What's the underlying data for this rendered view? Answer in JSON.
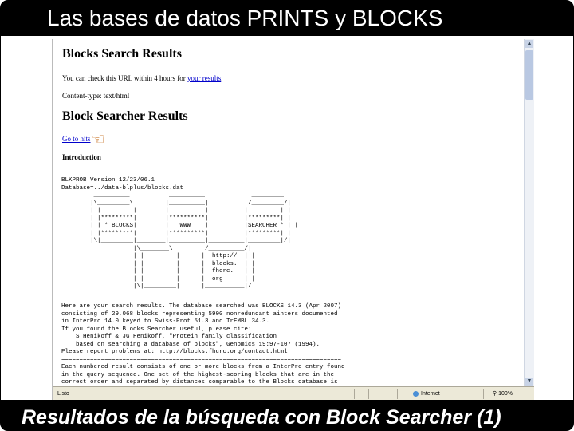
{
  "slide": {
    "title": "Las bases de datos PRINTS y BLOCKS",
    "caption": "Resultados de la búsqueda con Block Searcher (1)"
  },
  "page": {
    "heading": "Blocks Search Results",
    "check_text": "You can check this URL within 4 hours for ",
    "results_link": "your results",
    "check_suffix": ".",
    "content_type": "Content-type: text/html",
    "subheading": "Block Searcher Results",
    "goto_link": "Go to hits",
    "hand_icon": "pointing-hand-icon",
    "introduction": "Introduction",
    "ascii_block": "BLKPROB Version 12/23/06.1\nDatabase=../data-blplus/blocks.dat\n         __________           __________             _________\n        |\\_________\\         |__________|           /_________/|\n        | |         |        |          |          |         | |\n        | |*********|        |**********|          |*********| |\n        | | * BLOCKS|        |   WWW    |          |SEARCHER * | |\n        | |*********|        |**********|          |*********| |\n        |\\|_________|________|__________|__________|_________|/|\n                    |\\________\\         /__________/|\n                    | |         |      |  http://  | |\n                    | |         |      |  blocks.  | |\n                    | |         |      |  fhcrc.   | |\n                    | |         |      |  org      | |\n                    |\\|_________|      |___________|/",
    "results_block": "Here are your search results. The database searched was BLOCKS 14.3 (Apr 2007)\nconsisting of 29,068 blocks representing 5900 nonredundant ainters documented\nin InterPro 14.0 keyed to Swiss-Prot 51.3 and TrEMBL 34.3.\nIf you found the Blocks Searcher useful, please cite:\n    S Henikoff & JG Henikoff, \"Protein family classification\n    based on searching a database of blocks\", Genomics 19:97-107 (1994).\nPlease report problems at: http://blocks.fhcrc.org/contact.html\n==============================================================================\nEach numbered result consists of one or more blocks from a InterPro entry found\nin the query sequence. One set of the highest-scoring blocks that are in the\ncorrect order and separated by distances comparable to the Blocks database is"
  },
  "browser": {
    "status": "Listo",
    "zone": "Internet",
    "zoom": "100%"
  }
}
